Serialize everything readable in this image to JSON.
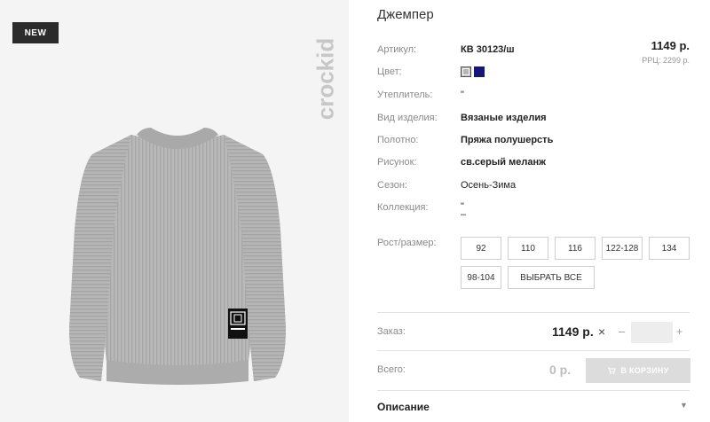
{
  "badge": "NEW",
  "brand": "crockid",
  "product": {
    "title": "Джемпер",
    "price": "1149 р.",
    "rrp": "РРЦ: 2299 р."
  },
  "attributes": {
    "article": {
      "label": "Артикул:",
      "value": "КВ 30123/ш"
    },
    "color": {
      "label": "Цвет:",
      "swatches": [
        "#b5b5b5",
        "#16167a"
      ]
    },
    "insulation": {
      "label": "Утеплитель:",
      "value": "\""
    },
    "product_type": {
      "label": "Вид изделия:",
      "value": "Вязаные изделия"
    },
    "fabric": {
      "label": "Полотно:",
      "value": "Пряжа полушерсть"
    },
    "pattern": {
      "label": "Рисунок:",
      "value": "св.серый меланж"
    },
    "season": {
      "label": "Сезон:",
      "value": "Осень-Зима"
    },
    "collection": {
      "label": "Коллекция:",
      "value": "\"",
      "value2": "–"
    }
  },
  "sizes": {
    "label": "Рост/размер:",
    "options": [
      "92",
      "110",
      "116",
      "122-128",
      "134",
      "98-104"
    ],
    "select_all": "ВЫБРАТЬ ВСЕ"
  },
  "order": {
    "label": "Заказ:",
    "price": "1149 р.",
    "times": "×",
    "minus": "–",
    "plus": "+",
    "quantity": ""
  },
  "total": {
    "label": "Всего:",
    "value": "0 р.",
    "cart_button": "В КОРЗИНУ"
  },
  "description": {
    "title": "Описание"
  }
}
